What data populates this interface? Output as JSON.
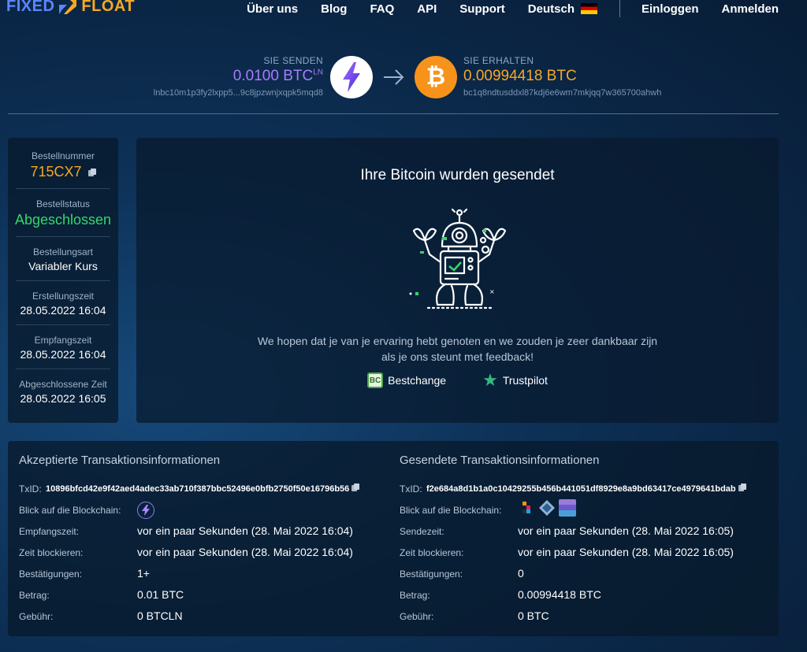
{
  "header": {
    "logo_left": "FIXED",
    "logo_right": "FLOAT",
    "nav": [
      "Über uns",
      "Blog",
      "FAQ",
      "API",
      "Support"
    ],
    "language": "Deutsch",
    "login": "Einloggen",
    "register": "Anmelden"
  },
  "transfer": {
    "send_label": "SIE SENDEN",
    "send_amount": "0.0100 BTC",
    "send_suffix": "LN",
    "send_address": "lnbc10m1p3fy2lxpp5...9c8jpzwnjxqpk5mqd8",
    "receive_label": "SIE ERHALTEN",
    "receive_amount": "0.00994418 BTC",
    "receive_address": "bc1q8ndtusddxl87kdj6e6wm7mkjqq7w365700ahwh",
    "btc_symbol": "₿"
  },
  "order": {
    "number_label": "Bestellnummer",
    "number": "715CX7",
    "status_label": "Bestellstatus",
    "status": "Abgeschlossen",
    "type_label": "Bestellungsart",
    "type": "Variabler Kurs",
    "created_label": "Erstellungszeit",
    "created": "28.05.2022 16:04",
    "received_label": "Empfangszeit",
    "received": "28.05.2022 16:04",
    "completed_label": "Abgeschlossene Zeit",
    "completed": "28.05.2022 16:05"
  },
  "success": {
    "title": "Ihre Bitcoin wurden gesendet",
    "message": "We hopen dat je van je ervaring hebt genoten en we zouden je zeer dankbaar zijn als je ons steunt met feedback!",
    "review_bestchange": "Bestchange",
    "bestchange_badge": "BC",
    "review_trustpilot": "Trustpilot"
  },
  "tx_accepted": {
    "title": "Akzeptierte Transaktionsinformationen",
    "txid_label": "TxID:",
    "txid": "10896bfcd42e9f42aed4adec33ab710f387bbc52496e0bfb2750f50e16796b56",
    "blockchain_label": "Blick auf die Blockchain:",
    "time_label": "Empfangszeit:",
    "time": "vor ein paar Sekunden (28. Mai 2022 16:04)",
    "block_label": "Zeit blockieren:",
    "block_time": "vor ein paar Sekunden (28. Mai 2022 16:04)",
    "confirm_label": "Bestätigungen:",
    "confirmations": "1+",
    "amount_label": "Betrag:",
    "amount": "0.01 BTC",
    "fee_label": "Gebühr:",
    "fee": "0 BTCLN"
  },
  "tx_sent": {
    "title": "Gesendete Transaktionsinformationen",
    "txid_label": "TxID:",
    "txid": "f2e684a8d1b1a0c10429255b456b441051df8929e8a9bd63417ce4979641bdab",
    "blockchain_label": "Blick auf die Blockchain:",
    "time_label": "Sendezeit:",
    "time": "vor ein paar Sekunden (28. Mai 2022 16:05)",
    "block_label": "Zeit blockieren:",
    "block_time": "vor ein paar Sekunden (28. Mai 2022 16:05)",
    "confirm_label": "Bestätigungen:",
    "confirmations": "0",
    "amount_label": "Betrag:",
    "amount": "0.00994418 BTC",
    "fee_label": "Gebühr:",
    "fee": "0 BTC"
  },
  "colors": {
    "accent_orange": "#f7a823",
    "accent_purple": "#a87bff",
    "status_green": "#35d66e"
  }
}
